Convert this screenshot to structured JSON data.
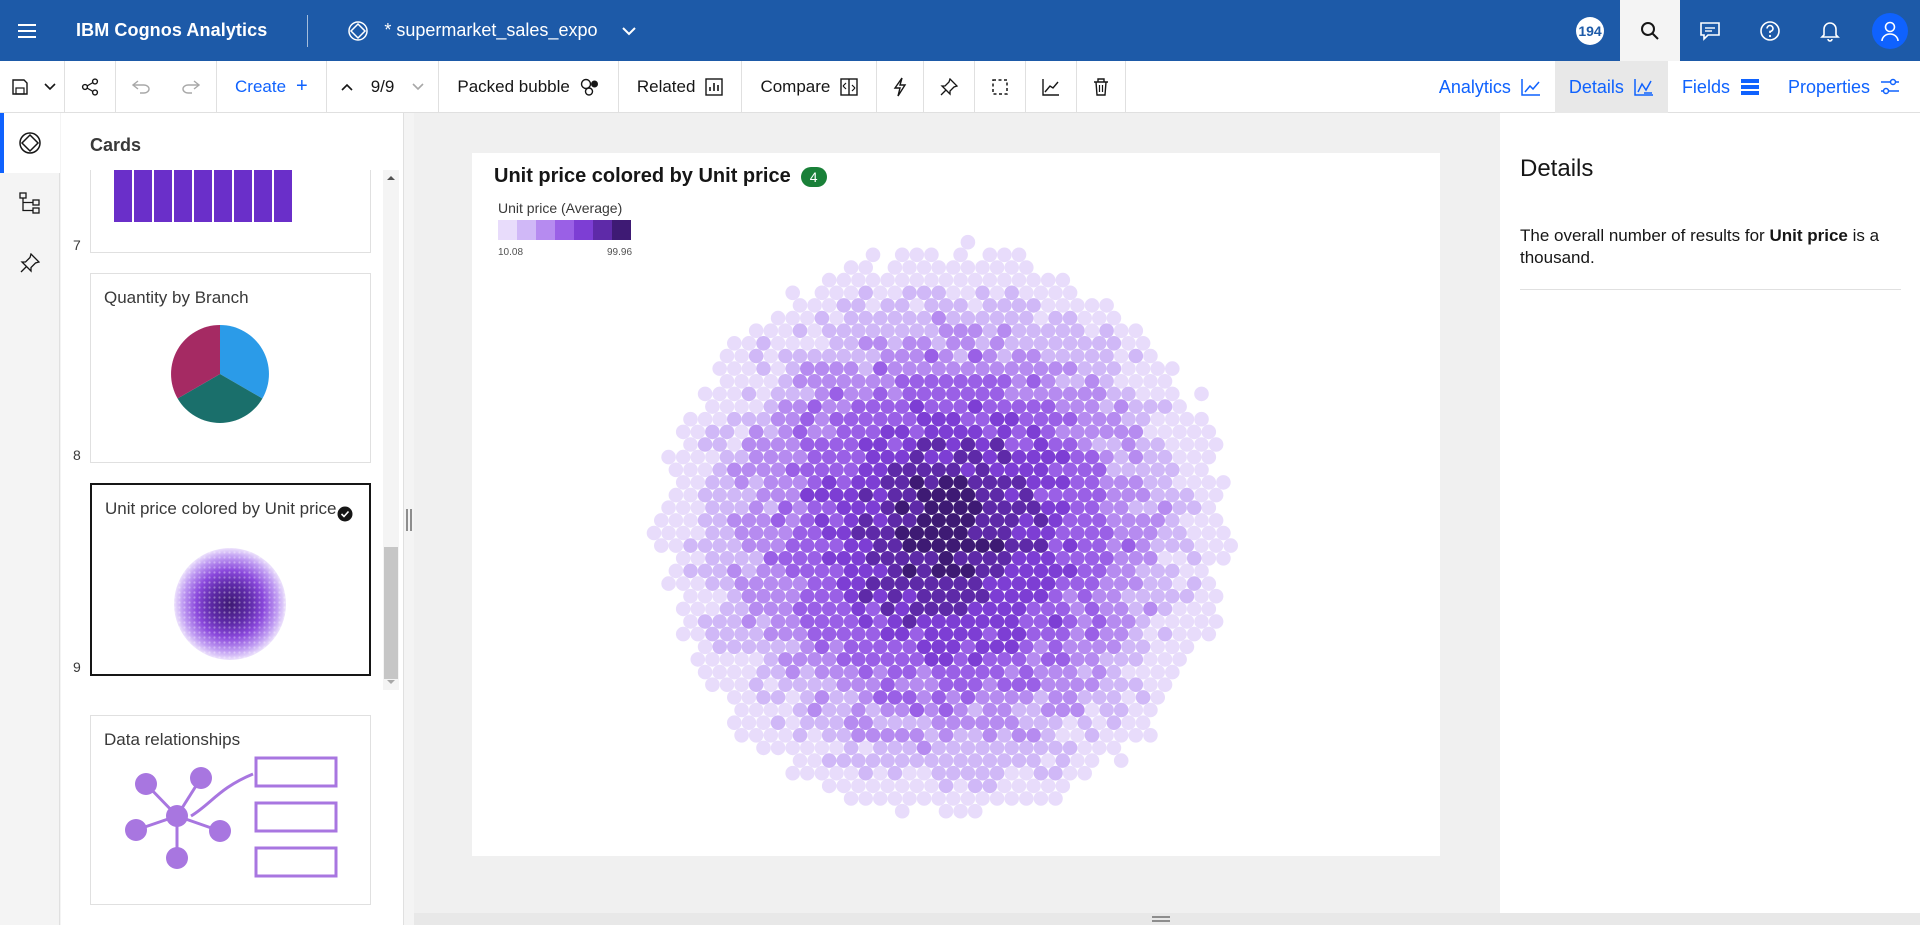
{
  "header": {
    "product": "IBM Cognos Analytics",
    "document_title": "* supermarket_sales_expo",
    "notification_count": "194"
  },
  "toolbar": {
    "create_label": "Create",
    "page_indicator": "9/9",
    "viz_type_label": "Packed bubble",
    "related_label": "Related",
    "compare_label": "Compare",
    "right_tabs": [
      {
        "label": "Analytics",
        "icon": "analytics-icon"
      },
      {
        "label": "Details",
        "icon": "details-icon",
        "active": true
      },
      {
        "label": "Fields",
        "icon": "fields-icon"
      },
      {
        "label": "Properties",
        "icon": "properties-icon"
      }
    ]
  },
  "cards_panel": {
    "title": "Cards",
    "cards": [
      {
        "number": "7",
        "title": ""
      },
      {
        "number": "8",
        "title": "Quantity by Branch"
      },
      {
        "number": "9",
        "title": "Unit price colored by Unit price",
        "selected": true
      },
      {
        "number": "",
        "title": "Data relationships"
      }
    ]
  },
  "visualization": {
    "title": "Unit price colored by Unit price",
    "badge": "4",
    "legend_title": "Unit price (Average)",
    "legend_min": "10.08",
    "legend_max": "99.96",
    "legend_colors": [
      "#e8dcfb",
      "#d0b8f7",
      "#b68bf0",
      "#9a60e6",
      "#7d3ed4",
      "#5e2aa8",
      "#3e1a74"
    ]
  },
  "details": {
    "heading": "Details",
    "text_before": "The overall number of results for ",
    "text_bold": "Unit price",
    "text_after": " is a thousand."
  },
  "colors": {
    "header_bg": "#1d5aa8",
    "accent": "#0f62fe",
    "pie": [
      "#2b9be8",
      "#1a6f6b",
      "#a52a63"
    ]
  }
}
